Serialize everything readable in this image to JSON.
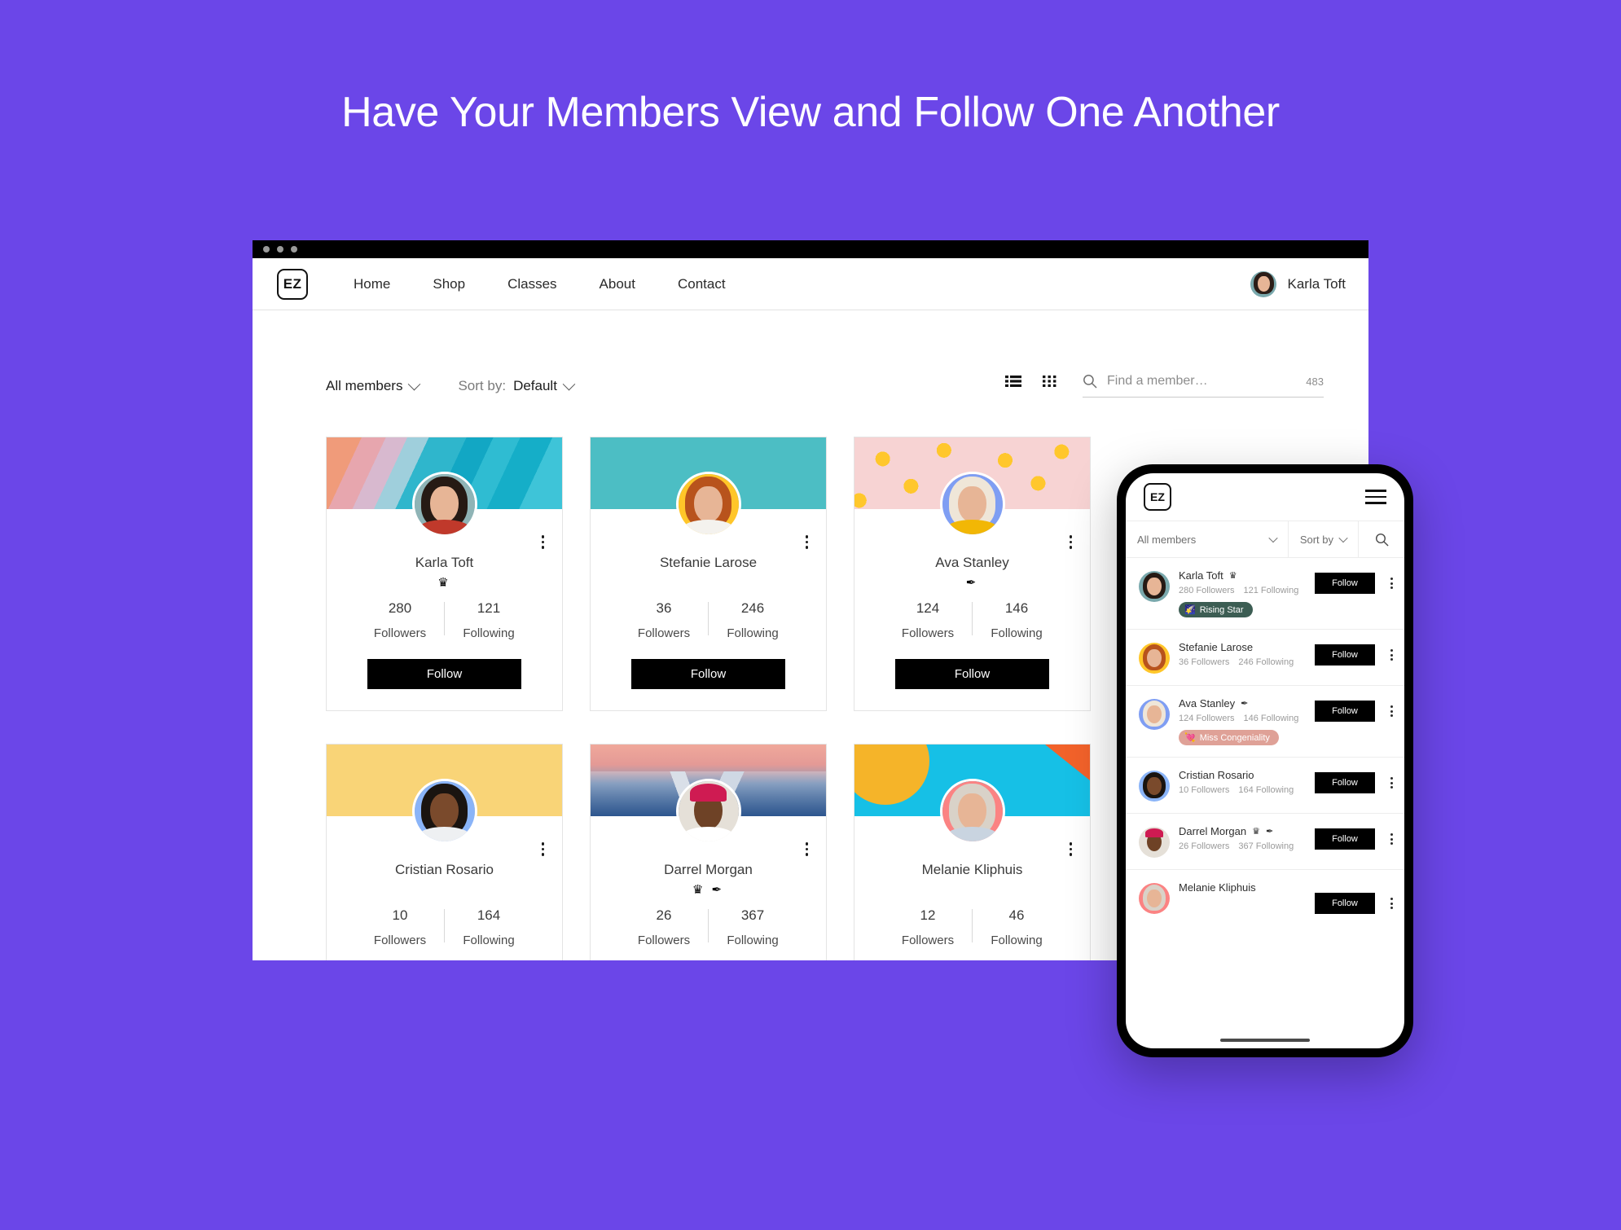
{
  "hero": {
    "title": "Have Your Members View and Follow One Another"
  },
  "theme": {
    "background": "#6b46e8",
    "accent_black": "#000000",
    "badge_rising_star_bg": "#3c5d53",
    "badge_miss_congeniality_bg": "#dfa197"
  },
  "browser": {
    "chrome_dots": 3,
    "nav": {
      "logo": "EZ",
      "links": [
        {
          "label": "Home"
        },
        {
          "label": "Shop"
        },
        {
          "label": "Classes"
        },
        {
          "label": "About"
        },
        {
          "label": "Contact"
        }
      ],
      "user": {
        "name": "Karla Toft",
        "avatar": "karla-avatar"
      }
    },
    "toolbar": {
      "filter_label": "All members",
      "sort_prefix": "Sort by:",
      "sort_value": "Default",
      "list_view_icon": "list-view-icon",
      "grid_view_icon": "grid-view-icon",
      "search_icon": "search-icon",
      "search_placeholder": "Find a member…",
      "search_value": "",
      "member_count": "483"
    },
    "labels": {
      "followers": "Followers",
      "following": "Following",
      "follow_button": "Follow",
      "kebab": "more-options"
    },
    "members": [
      {
        "name": "Karla Toft",
        "followers": "280",
        "following": "121",
        "badges": [
          "crown"
        ],
        "cover": "cov-stripes",
        "portrait": "karla"
      },
      {
        "name": "Stefanie Larose",
        "followers": "36",
        "following": "246",
        "badges": [],
        "cover": "cov-teal",
        "portrait": "stefanie"
      },
      {
        "name": "Ava Stanley",
        "followers": "124",
        "following": "146",
        "badges": [
          "quill"
        ],
        "cover": "cov-boxes",
        "portrait": "ava"
      },
      {
        "name": "Cristian Rosario",
        "followers": "10",
        "following": "164",
        "badges": [],
        "cover": "cov-yellow",
        "portrait": "cristian"
      },
      {
        "name": "Darrel Morgan",
        "followers": "26",
        "following": "367",
        "badges": [
          "crown",
          "quill"
        ],
        "cover": "cov-mountain",
        "portrait": "darrel"
      },
      {
        "name": "Melanie Kliphuis",
        "followers": "12",
        "following": "46",
        "badges": [],
        "cover": "cov-cyan",
        "portrait": "melanie"
      }
    ]
  },
  "phone": {
    "logo": "EZ",
    "menu_icon": "hamburger-menu-icon",
    "filter_label": "All members",
    "sort_label": "Sort by",
    "search_icon": "search-icon",
    "follow_button": "Follow",
    "rows": [
      {
        "name": "Karla Toft",
        "badges": [
          "crown"
        ],
        "followers": "280 Followers",
        "following": "121 Following",
        "award": {
          "label": "Rising Star",
          "emoji": "🌠",
          "bg": "#3c5d53"
        },
        "portrait": "karla"
      },
      {
        "name": "Stefanie Larose",
        "badges": [],
        "followers": "36 Followers",
        "following": "246 Following",
        "award": null,
        "portrait": "stefanie"
      },
      {
        "name": "Ava Stanley",
        "badges": [
          "quill"
        ],
        "followers": "124 Followers",
        "following": "146 Following",
        "award": {
          "label": "Miss Congeniality",
          "emoji": "💘",
          "bg": "#dfa197"
        },
        "portrait": "ava"
      },
      {
        "name": "Cristian Rosario",
        "badges": [],
        "followers": "10 Followers",
        "following": "164 Following",
        "award": null,
        "portrait": "cristian"
      },
      {
        "name": "Darrel Morgan",
        "badges": [
          "crown",
          "quill"
        ],
        "followers": "26 Followers",
        "following": "367 Following",
        "award": null,
        "portrait": "darrel"
      },
      {
        "name": "Melanie Kliphuis",
        "badges": [],
        "followers": "",
        "following": "",
        "award": null,
        "portrait": "melanie"
      }
    ]
  }
}
